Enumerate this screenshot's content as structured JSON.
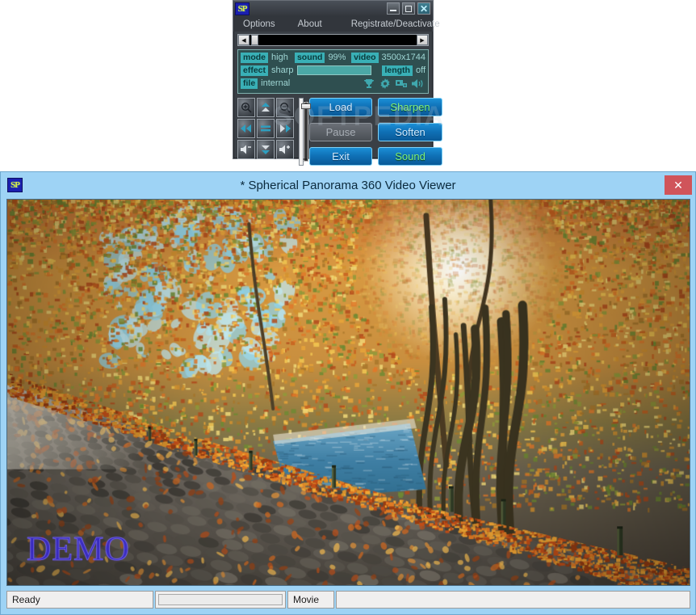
{
  "control_window": {
    "logo": "SP",
    "window_buttons": [
      {
        "name": "minimize",
        "glyph": "_"
      },
      {
        "name": "maximize",
        "glyph": "□"
      },
      {
        "name": "close",
        "glyph": "✕"
      }
    ],
    "menu": [
      "Options",
      "About",
      "Registrate/Deactivate"
    ],
    "info": {
      "mode_tag": "mode",
      "mode_value": "high",
      "sound_tag": "sound",
      "sound_value": "99%",
      "video_tag": "video",
      "video_value": "3500x1744",
      "effect_tag": "effect",
      "effect_value": "sharp",
      "length_tag": "length",
      "length_value": "off",
      "file_tag": "file",
      "file_value": "internal",
      "icons": [
        "trophy-icon",
        "gear-icon",
        "monitor-icon",
        "speaker-icon"
      ]
    },
    "dpad": [
      "zoom-in-icon",
      "pan-up-icon",
      "zoom-out-icon",
      "rewind-icon",
      "stop-icon",
      "fast-forward-icon",
      "volume-down-icon",
      "pan-down-icon",
      "volume-up-icon"
    ],
    "slider": {
      "plus": "+",
      "minus": "−"
    },
    "buttons": {
      "load": "Load",
      "pause": "Pause",
      "exit": "Exit",
      "sharpen": "Sharpen",
      "soften": "Soften",
      "sound": "Sound"
    },
    "watermark": "SOFTPEDIA"
  },
  "main_window": {
    "logo": "SP",
    "title": "* Spherical Panorama 360 Video Viewer",
    "close_glyph": "✕",
    "video_watermark": "DEMO",
    "statusbar": {
      "status": "Ready",
      "mode": "Movie"
    }
  },
  "colors": {
    "title_bar": "#9ed3f5",
    "close_red": "#d0545a",
    "accent_teal": "#39b0b6",
    "button_blue": "#0f6fb4",
    "green_text": "#7ef07e"
  }
}
